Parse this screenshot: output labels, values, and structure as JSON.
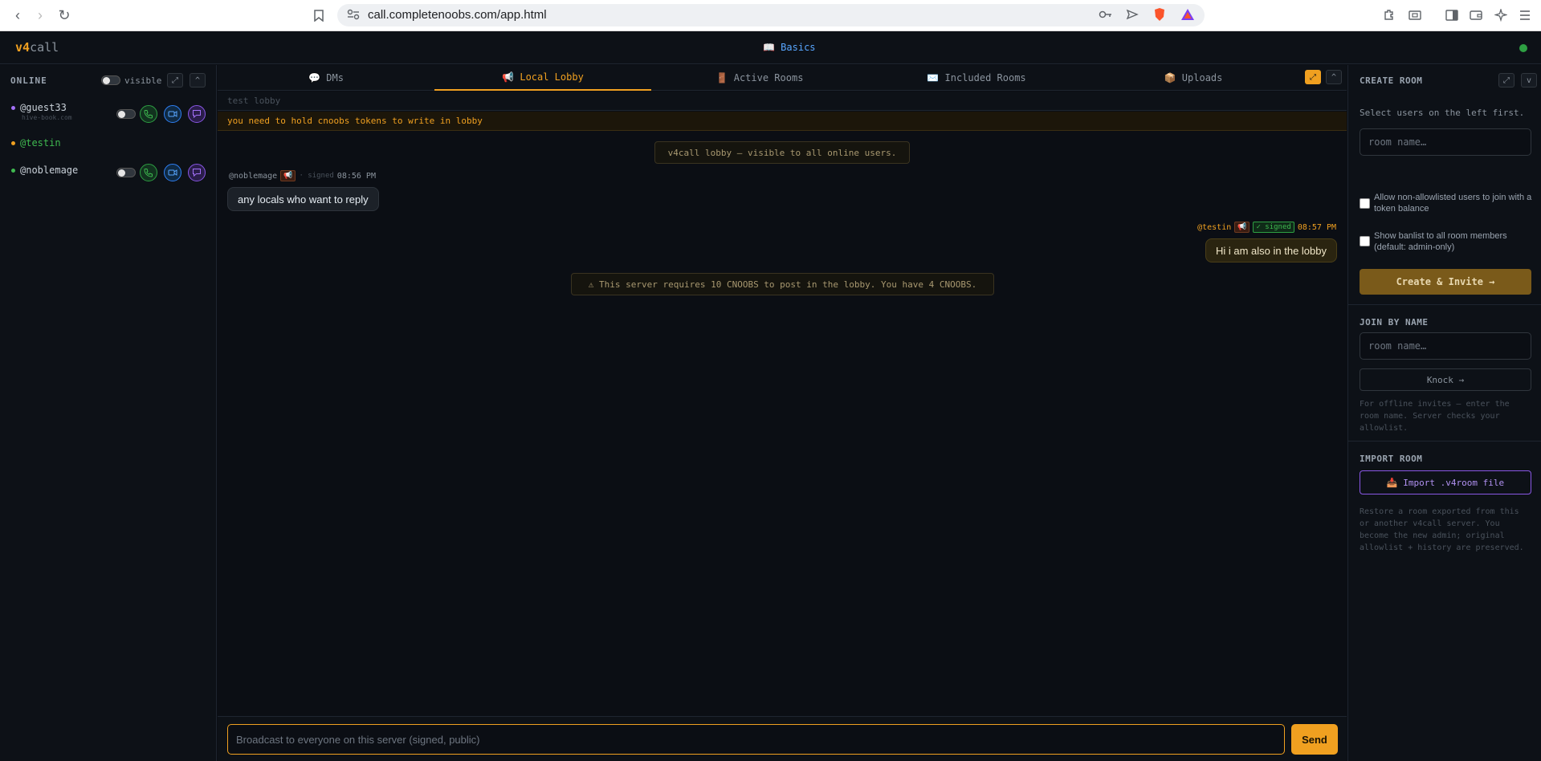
{
  "browser": {
    "url": "call.completenoobs.com/app.html"
  },
  "app": {
    "logo_bold": "v4",
    "logo_rest": "call",
    "basics_label": "📖 Basics",
    "status_color": "#2ea043"
  },
  "left": {
    "header": "ONLINE",
    "visible_label": "visible",
    "users": [
      {
        "name": "@guest33",
        "sub": "hive-book.com",
        "dot": "#a371f7"
      },
      {
        "name": "@testin",
        "sub": "",
        "dot": "#f0a020"
      },
      {
        "name": "@noblemage",
        "sub": "",
        "dot": "#3fb950"
      }
    ]
  },
  "tabs": [
    {
      "label": "💬 DMs",
      "active": false
    },
    {
      "label": "📢 Local Lobby",
      "active": true
    },
    {
      "label": "🚪 Active Rooms",
      "active": false
    },
    {
      "label": "✉️ Included Rooms",
      "active": false
    },
    {
      "label": "📦 Uploads",
      "active": false
    }
  ],
  "room": {
    "description": "test lobby",
    "warning": "you need to hold cnoobs tokens to write in lobby"
  },
  "chat": {
    "system_intro": "v4call lobby — visible to all online users.",
    "messages": [
      {
        "author": "@noblemage",
        "badge": "📢",
        "signed": "· signed",
        "time": "08:56 PM",
        "text": "any locals who want to reply"
      },
      {
        "author": "@testin",
        "badge": "📢",
        "signed": "✓ signed",
        "time": "08:57 PM",
        "text": "Hi i am also in the lobby"
      }
    ],
    "system_warning": "⚠ This server requires 10 CNOOBS to post in the lobby. You have 4 CNOOBS."
  },
  "composer": {
    "placeholder": "Broadcast to everyone on this server (signed, public)",
    "send_label": "Send"
  },
  "right": {
    "create_header": "CREATE ROOM",
    "create_hint": "Select users on the left first.",
    "room_name_placeholder": "room name…",
    "allow_label": "Allow non-allowlisted users to join with a token balance",
    "banlist_label": "Show banlist to all room members (default: admin-only)",
    "create_button": "Create & Invite →",
    "join_header": "JOIN BY NAME",
    "join_placeholder": "room name…",
    "knock_button": "Knock →",
    "offline_hint": "For offline invites — enter the room name. Server checks your allowlist.",
    "import_header": "IMPORT ROOM",
    "import_button": "📥 Import .v4room file",
    "import_hint": "Restore a room exported from this or another v4call server. You become the new admin; original allowlist + history are preserved."
  }
}
